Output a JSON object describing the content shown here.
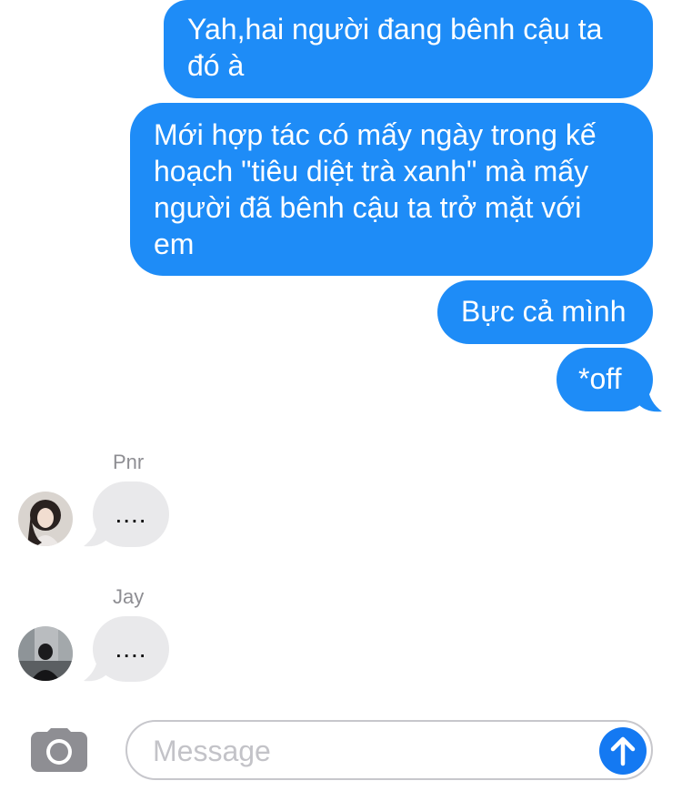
{
  "conversation": {
    "outgoing": [
      {
        "text": "Yah,hai người đang bênh cậu ta đó à"
      },
      {
        "text": "Mới hợp tác có mấy ngày trong kế hoạch \"tiêu diệt trà xanh\" mà mấy người đã bênh cậu ta trở mặt với em"
      },
      {
        "text": "Bực cả mình"
      },
      {
        "text": "*off"
      }
    ],
    "incoming": [
      {
        "sender": "Pnr",
        "text": "...."
      },
      {
        "sender": "Jay",
        "text": "...."
      }
    ]
  },
  "composer": {
    "placeholder": "Message",
    "camera_icon": "camera-icon",
    "send_icon": "arrow-up-icon"
  },
  "colors": {
    "outgoing_bubble": "#1e8cf7",
    "incoming_bubble": "#e9e9eb",
    "send_button": "#1479f2"
  }
}
